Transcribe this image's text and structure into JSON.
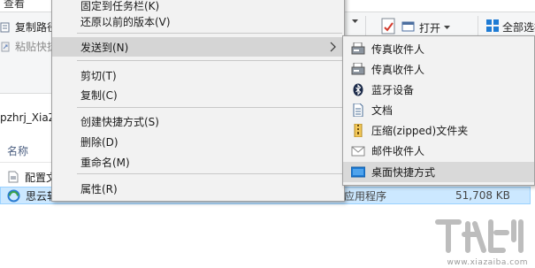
{
  "explorer": {
    "tab_label": "查看",
    "ribbon": {
      "copy_path": "复制路径",
      "paste_shortcut": "粘贴快捷",
      "open": "打开",
      "select_all": "全部选择"
    },
    "address_fragment": "pzhrj_XiaZ",
    "column_name": "名称",
    "files": [
      {
        "name": "配置文",
        "type": "",
        "size": ""
      },
      {
        "name": "思云软",
        "type": "应用程序",
        "size": "51,708 KB"
      }
    ]
  },
  "context_menu": {
    "items": [
      {
        "label": "固定到任务栏(K)"
      },
      {
        "label": "还原以前的版本(V)"
      },
      {
        "label": "发送到(N)"
      },
      {
        "label": "剪切(T)"
      },
      {
        "label": "复制(C)"
      },
      {
        "label": "创建快捷方式(S)"
      },
      {
        "label": "删除(D)"
      },
      {
        "label": "重命名(M)"
      },
      {
        "label": "属性(R)"
      }
    ]
  },
  "send_to_menu": {
    "items": [
      {
        "label": "传真收件人",
        "icon": "fax-icon"
      },
      {
        "label": "传真收件人",
        "icon": "fax-icon"
      },
      {
        "label": "蓝牙设备",
        "icon": "bluetooth-icon"
      },
      {
        "label": "文档",
        "icon": "documents-icon"
      },
      {
        "label": "压缩(zipped)文件夹",
        "icon": "zip-folder-icon"
      },
      {
        "label": "邮件收件人",
        "icon": "mail-icon"
      },
      {
        "label": "桌面快捷方式",
        "icon": "desktop-icon"
      }
    ]
  },
  "watermark": {
    "text": "www.xiazaiba.com"
  },
  "colors": {
    "menu_bg": "#f2f2f2",
    "menu_hover": "#d5d5d5",
    "selection_bg": "#cce8ff",
    "accent": "#1e7bd4"
  }
}
